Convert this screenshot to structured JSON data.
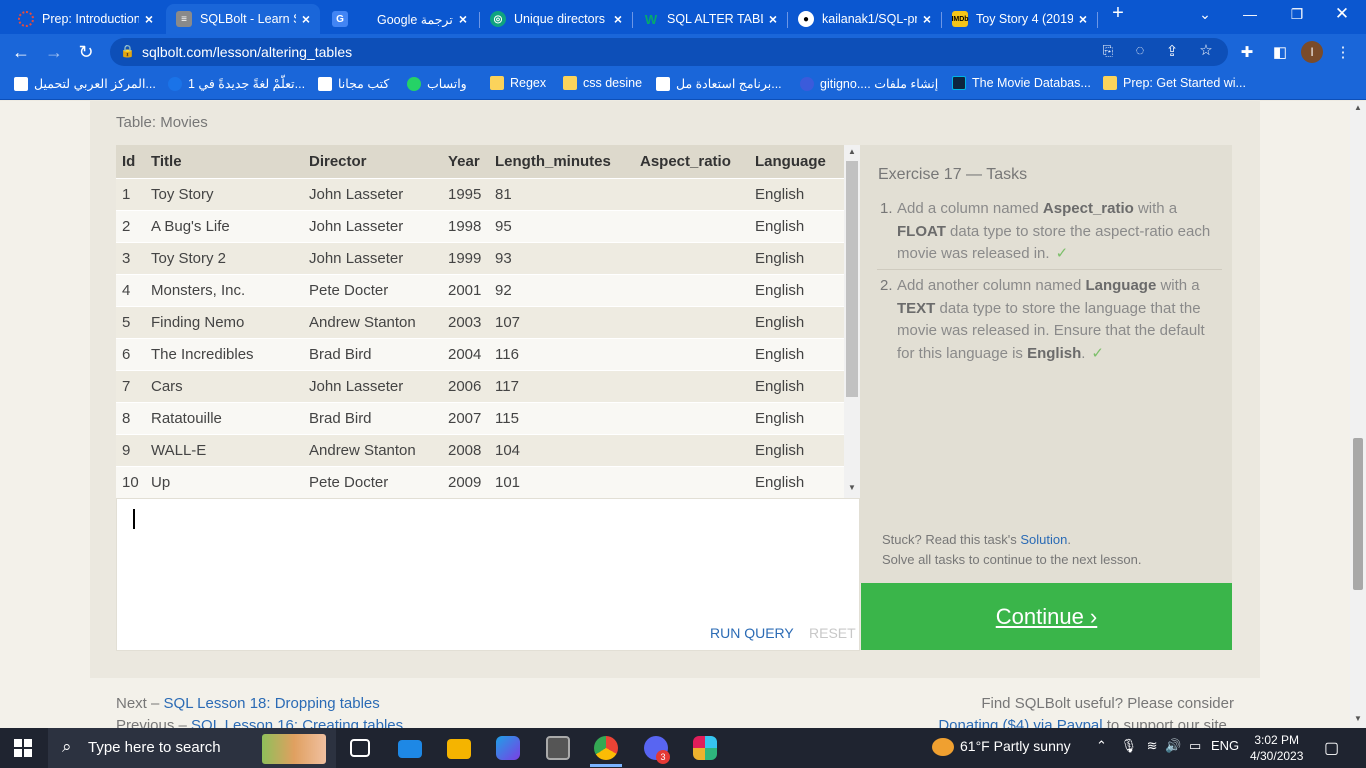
{
  "browser": {
    "tabs": [
      {
        "title": "Prep: Introduction",
        "icon": "loading-icon",
        "color": "#e84b3c"
      },
      {
        "title": "SQLBolt - Learn S",
        "icon": "database-icon",
        "color": "#ffffff"
      },
      {
        "title": "Google ترجمة",
        "icon": "translate-icon",
        "color": "#4285f4"
      },
      {
        "title": "Unique directors",
        "icon": "chatgpt-icon",
        "color": "#10a37f"
      },
      {
        "title": "SQL ALTER TABLE",
        "icon": "w3schools-icon",
        "color": "#04aa6d"
      },
      {
        "title": "kailanak1/SQL-pr",
        "icon": "github-icon",
        "color": "#000000"
      },
      {
        "title": "Toy Story 4 (2019",
        "icon": "imdb-icon",
        "color": "#f5c518"
      }
    ],
    "new_tab": "+",
    "url": "sqlbolt.com/lesson/altering_tables",
    "profile_initial": "I",
    "bookmarks": [
      {
        "label": "المركز العربي لتحميل...",
        "color": "#ffffff"
      },
      {
        "label": "تعلّمْ لغةً جديدةً في 1...",
        "color": "#1a73e8"
      },
      {
        "label": "كتب مجانا",
        "color": "#ffffff"
      },
      {
        "label": "واتساب",
        "color": "#25d366"
      },
      {
        "label": "Regex",
        "color": "#fbd35b"
      },
      {
        "label": "css desine",
        "color": "#fbd35b"
      },
      {
        "label": "برنامج استعادة مل...",
        "color": "#ffffff"
      },
      {
        "label": "gitigno.... إنشاء ملفات",
        "color": "#3b5bdb"
      },
      {
        "label": "The Movie Databas...",
        "color": "#0d253f"
      },
      {
        "label": "Prep: Get Started wi...",
        "color": "#fbd35b"
      }
    ]
  },
  "lesson": {
    "table_caption": "Table: Movies",
    "columns": [
      "Id",
      "Title",
      "Director",
      "Year",
      "Length_minutes",
      "Aspect_ratio",
      "Language"
    ],
    "rows": [
      [
        "1",
        "Toy Story",
        "John Lasseter",
        "1995",
        "81",
        "",
        "English"
      ],
      [
        "2",
        "A Bug's Life",
        "John Lasseter",
        "1998",
        "95",
        "",
        "English"
      ],
      [
        "3",
        "Toy Story 2",
        "John Lasseter",
        "1999",
        "93",
        "",
        "English"
      ],
      [
        "4",
        "Monsters, Inc.",
        "Pete Docter",
        "2001",
        "92",
        "",
        "English"
      ],
      [
        "5",
        "Finding Nemo",
        "Andrew Stanton",
        "2003",
        "107",
        "",
        "English"
      ],
      [
        "6",
        "The Incredibles",
        "Brad Bird",
        "2004",
        "116",
        "",
        "English"
      ],
      [
        "7",
        "Cars",
        "John Lasseter",
        "2006",
        "117",
        "",
        "English"
      ],
      [
        "8",
        "Ratatouille",
        "Brad Bird",
        "2007",
        "115",
        "",
        "English"
      ],
      [
        "9",
        "WALL-E",
        "Andrew Stanton",
        "2008",
        "104",
        "",
        "English"
      ],
      [
        "10",
        "Up",
        "Pete Docter",
        "2009",
        "101",
        "",
        "English"
      ]
    ],
    "editor_value": "",
    "run_label": "RUN QUERY",
    "reset_label": "RESET",
    "exercise_title": "Exercise 17 — Tasks",
    "task1": {
      "num": "1.",
      "pre": "Add a column named ",
      "b1": "Aspect_ratio",
      "mid": " with a ",
      "b2": "FLOAT",
      "post": " data type to store the aspect-ratio each movie was released in.",
      "check": "✓"
    },
    "task2": {
      "num": "2.",
      "pre": "Add another column named ",
      "b1": "Language",
      "mid": " with a ",
      "b2": "TEXT",
      "post": " data type to store the language that the movie was released in. Ensure that the default for this language is ",
      "b3": "English",
      "end": ".",
      "check": "✓"
    },
    "stuck_pre": "Stuck? Read this task's ",
    "stuck_link": "Solution",
    "stuck_post": ".",
    "solve_all": "Solve all tasks to continue to the next lesson.",
    "continue_label": "Continue ›",
    "next_pre": "Next – ",
    "next_link": "SQL Lesson 18: Dropping tables",
    "prev_pre": "Previous – ",
    "prev_link": "SQL Lesson 16: Creating tables",
    "useful": "Find SQLBolt useful? Please consider",
    "donate_link": "Donating ($4) via Paypal",
    "donate_post": " to support our site."
  },
  "taskbar": {
    "search_placeholder": "Type here to search",
    "weather": "61°F  Partly sunny",
    "lang": "ENG",
    "time": "3:02 PM",
    "date": "4/30/2023",
    "notification_badge": "3"
  }
}
